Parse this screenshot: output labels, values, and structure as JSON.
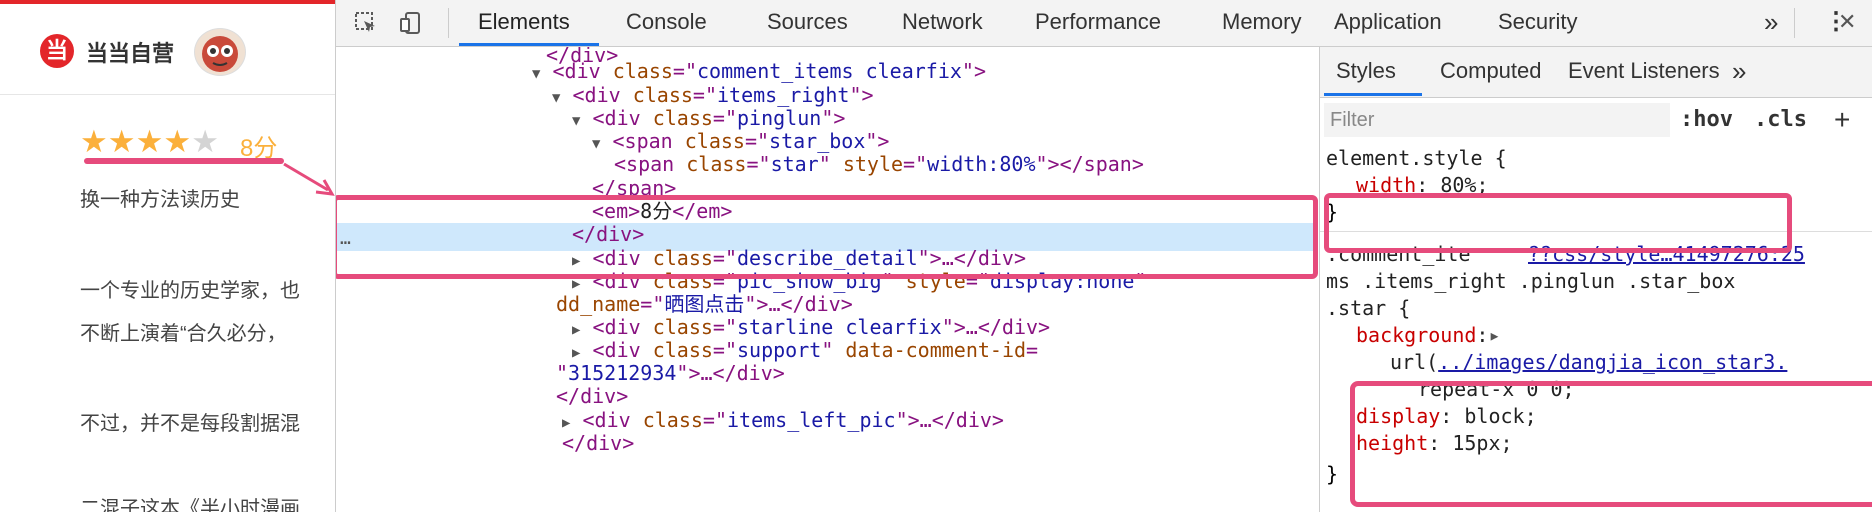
{
  "left_page": {
    "store_name": "当当自营",
    "logo_char": "当",
    "rating": {
      "filled": 4,
      "total": 5,
      "score_label": "8分"
    },
    "lines": [
      "换一种方法读历史",
      "一个专业的历史学家，也",
      "不断上演着“合久必分，",
      "不过，并不是每段割据混",
      "二混子这本《半小时漫画"
    ]
  },
  "devtools": {
    "tabs": [
      "Elements",
      "Console",
      "Sources",
      "Network",
      "Performance",
      "Memory",
      "Application",
      "Security"
    ],
    "more_tabs": "»",
    "menu_icon": "⋮",
    "close_icon": "✕",
    "dom_lines": [
      {
        "indent": 0,
        "tri": "",
        "segments": [
          {
            "t": "tag",
            "v": "</div>"
          }
        ]
      },
      {
        "indent": 1,
        "tri": "▼",
        "segments": [
          {
            "t": "tag",
            "v": "<div "
          },
          {
            "t": "attr",
            "v": "class"
          },
          {
            "t": "tag",
            "v": "=\""
          },
          {
            "t": "val",
            "v": "comment_items clearfix"
          },
          {
            "t": "tag",
            "v": "\">"
          }
        ]
      },
      {
        "indent": 2,
        "tri": "▼",
        "segments": [
          {
            "t": "tag",
            "v": "<div "
          },
          {
            "t": "attr",
            "v": "class"
          },
          {
            "t": "tag",
            "v": "=\""
          },
          {
            "t": "val",
            "v": "items_right"
          },
          {
            "t": "tag",
            "v": "\">"
          }
        ]
      },
      {
        "indent": 3,
        "tri": "▼",
        "segments": [
          {
            "t": "tag",
            "v": "<div "
          },
          {
            "t": "attr",
            "v": "class"
          },
          {
            "t": "tag",
            "v": "=\""
          },
          {
            "t": "val",
            "v": "pinglun"
          },
          {
            "t": "tag",
            "v": "\">"
          }
        ]
      },
      {
        "indent": 4,
        "tri": "▼",
        "segments": [
          {
            "t": "tag",
            "v": "<span "
          },
          {
            "t": "attr",
            "v": "class"
          },
          {
            "t": "tag",
            "v": "=\""
          },
          {
            "t": "val",
            "v": "star_box"
          },
          {
            "t": "tag",
            "v": "\">"
          }
        ]
      },
      {
        "indent": 5,
        "tri": "",
        "segments": [
          {
            "t": "tag",
            "v": "<span "
          },
          {
            "t": "attr",
            "v": "class"
          },
          {
            "t": "tag",
            "v": "=\""
          },
          {
            "t": "val",
            "v": "star"
          },
          {
            "t": "tag",
            "v": "\" "
          },
          {
            "t": "attr",
            "v": "style"
          },
          {
            "t": "tag",
            "v": "=\""
          },
          {
            "t": "val",
            "v": "width:80%"
          },
          {
            "t": "tag",
            "v": "\"></span>"
          }
        ]
      },
      {
        "indent": 4,
        "tri": "",
        "segments": [
          {
            "t": "tag",
            "v": "</span>"
          }
        ]
      },
      {
        "indent": 4,
        "tri": "",
        "segments": [
          {
            "t": "tag",
            "v": "<em>"
          },
          {
            "t": "txt",
            "v": "8分"
          },
          {
            "t": "tag",
            "v": "</em>"
          }
        ]
      },
      {
        "indent": 3,
        "tri": "",
        "segments": [
          {
            "t": "tag",
            "v": "</div>"
          }
        ]
      },
      {
        "indent": 3,
        "tri": "▶",
        "segments": [
          {
            "t": "tag",
            "v": "<div "
          },
          {
            "t": "attr",
            "v": "class"
          },
          {
            "t": "tag",
            "v": "=\""
          },
          {
            "t": "val",
            "v": "describe_detail"
          },
          {
            "t": "tag",
            "v": "\">…</div>"
          }
        ]
      },
      {
        "indent": 3,
        "tri": "▶",
        "segments": [
          {
            "t": "tag",
            "v": "<div "
          },
          {
            "t": "attr",
            "v": "class"
          },
          {
            "t": "tag",
            "v": "=\""
          },
          {
            "t": "val",
            "v": "pic_show_big"
          },
          {
            "t": "tag",
            "v": "\" "
          },
          {
            "t": "attr",
            "v": "style"
          },
          {
            "t": "tag",
            "v": "=\""
          },
          {
            "t": "val",
            "v": "display:none"
          },
          {
            "t": "tag",
            "v": "\""
          }
        ]
      },
      {
        "indent": 3,
        "tri": "",
        "segments": [
          {
            "t": "attr",
            "v": "dd_name"
          },
          {
            "t": "tag",
            "v": "=\""
          },
          {
            "t": "val",
            "v": "晒图点击"
          },
          {
            "t": "tag",
            "v": "\">…</div>"
          }
        ]
      },
      {
        "indent": 3,
        "tri": "▶",
        "segments": [
          {
            "t": "tag",
            "v": "<div "
          },
          {
            "t": "attr",
            "v": "class"
          },
          {
            "t": "tag",
            "v": "=\""
          },
          {
            "t": "val",
            "v": "starline clearfix"
          },
          {
            "t": "tag",
            "v": "\">…</div>"
          }
        ]
      },
      {
        "indent": 3,
        "tri": "▶",
        "segments": [
          {
            "t": "tag",
            "v": "<div "
          },
          {
            "t": "attr",
            "v": "class"
          },
          {
            "t": "tag",
            "v": "=\""
          },
          {
            "t": "val",
            "v": "support"
          },
          {
            "t": "tag",
            "v": "\" "
          },
          {
            "t": "attr",
            "v": "data-comment-id"
          },
          {
            "t": "tag",
            "v": "="
          }
        ]
      },
      {
        "indent": 3,
        "tri": "",
        "segments": [
          {
            "t": "tag",
            "v": "\""
          },
          {
            "t": "val",
            "v": "315212934"
          },
          {
            "t": "tag",
            "v": "\">…</div>"
          }
        ]
      },
      {
        "indent": 3,
        "tri": "",
        "segments": [
          {
            "t": "tag",
            "v": "</div>"
          }
        ]
      },
      {
        "indent": 2,
        "tri": "▶",
        "segments": [
          {
            "t": "tag",
            "v": "<div "
          },
          {
            "t": "attr",
            "v": "class"
          },
          {
            "t": "tag",
            "v": "=\""
          },
          {
            "t": "val",
            "v": "items_left_pic"
          },
          {
            "t": "tag",
            "v": "\">…</div>"
          }
        ]
      },
      {
        "indent": 2,
        "tri": "",
        "segments": [
          {
            "t": "tag",
            "v": "</div>"
          }
        ]
      }
    ],
    "selected_marker": "…",
    "styles": {
      "tabs": [
        "Styles",
        "Computed",
        "Event Listeners"
      ],
      "more_tabs": "»",
      "filter_placeholder": "Filter",
      "hov": ":hov",
      "cls": ".cls",
      "add": "+",
      "element_style": {
        "selector": "element.style {",
        "props": [
          {
            "name": "width",
            "value": "80%;"
          }
        ],
        "close": "}"
      },
      "rule": {
        "selector_line1": ".comment_ite",
        "source": "??css/style…41497276:25",
        "selector_line2": "ms .items_right .pinglun .star_box",
        "selector_line3": ".star {",
        "background_name": "background",
        "background_arrow": "▸",
        "url_prefix": "url(",
        "url_link": "../images/dangjia_icon_star3.",
        "repeat": "repeat-x 0 0;",
        "display_name": "display",
        "display_value": "block;",
        "height_name": "height",
        "height_value": "15px;",
        "close": "}"
      }
    }
  },
  "colors": {
    "accent_pink": "#e64b7c",
    "brand_red": "#e3262a",
    "star_yellow": "#fbb03b",
    "selection_blue": "#cfe8fc"
  }
}
